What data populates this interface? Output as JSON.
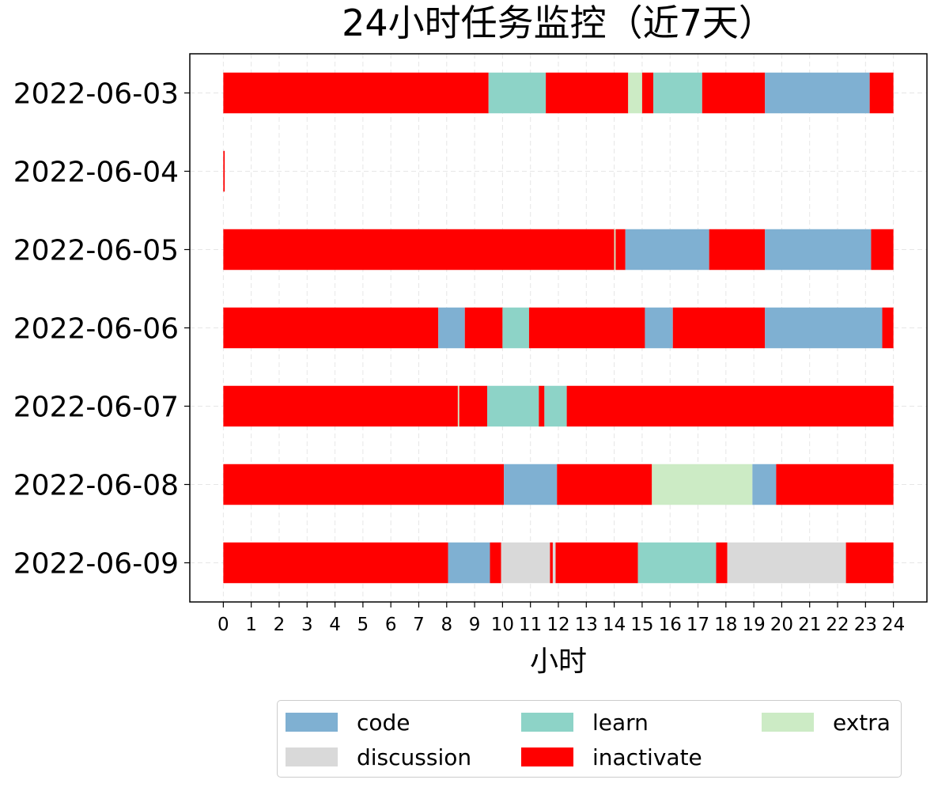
{
  "chart_data": {
    "type": "bar",
    "orientation": "horizontal",
    "stacked": true,
    "title": "24小时任务监控（近7天）",
    "xlabel": "小时",
    "ylabel": "",
    "xlim": [
      -1.2,
      25.2
    ],
    "x_ticks": [
      0,
      1,
      2,
      3,
      4,
      5,
      6,
      7,
      8,
      9,
      10,
      11,
      12,
      13,
      14,
      15,
      16,
      17,
      18,
      19,
      20,
      21,
      22,
      23,
      24
    ],
    "x_tick_labels": [
      "0",
      "1",
      "2",
      "3",
      "4",
      "5",
      "6",
      "7",
      "8",
      "9",
      "10",
      "11",
      "12",
      "13",
      "14",
      "15",
      "16",
      "17",
      "18",
      "19",
      "20",
      "21",
      "22",
      "23",
      "24"
    ],
    "grid": true,
    "legend_position": "bottom",
    "categories": [
      "2022-06-03",
      "2022-06-04",
      "2022-06-05",
      "2022-06-06",
      "2022-06-07",
      "2022-06-08",
      "2022-06-09"
    ],
    "colors": {
      "code": "#7fb0d2",
      "discussion": "#d9d9d9",
      "learn": "#8dd3c7",
      "inactivate": "#ff0000",
      "extra": "#ccebc5"
    },
    "legend": [
      "code",
      "discussion",
      "learn",
      "inactivate",
      "extra"
    ],
    "rows": [
      {
        "date": "2022-06-03",
        "segments": [
          {
            "start": 0,
            "end": 9.5,
            "type": "inactivate"
          },
          {
            "start": 9.5,
            "end": 11.55,
            "type": "learn"
          },
          {
            "start": 11.55,
            "end": 14.5,
            "type": "inactivate"
          },
          {
            "start": 14.5,
            "end": 15.0,
            "type": "extra"
          },
          {
            "start": 15.0,
            "end": 15.4,
            "type": "inactivate"
          },
          {
            "start": 15.4,
            "end": 17.15,
            "type": "learn"
          },
          {
            "start": 17.15,
            "end": 19.4,
            "type": "inactivate"
          },
          {
            "start": 19.4,
            "end": 23.15,
            "type": "code"
          },
          {
            "start": 23.15,
            "end": 24.0,
            "type": "inactivate"
          }
        ]
      },
      {
        "date": "2022-06-04",
        "segments": [
          {
            "start": 0,
            "end": 0.05,
            "type": "inactivate"
          }
        ]
      },
      {
        "date": "2022-06-05",
        "segments": [
          {
            "start": 0,
            "end": 14.0,
            "type": "inactivate"
          },
          {
            "start": 14.0,
            "end": 14.05,
            "type": "extra"
          },
          {
            "start": 14.05,
            "end": 14.4,
            "type": "inactivate"
          },
          {
            "start": 14.4,
            "end": 17.4,
            "type": "code"
          },
          {
            "start": 17.4,
            "end": 19.4,
            "type": "inactivate"
          },
          {
            "start": 19.4,
            "end": 23.2,
            "type": "code"
          },
          {
            "start": 23.2,
            "end": 24.0,
            "type": "inactivate"
          }
        ]
      },
      {
        "date": "2022-06-06",
        "segments": [
          {
            "start": 0,
            "end": 7.7,
            "type": "inactivate"
          },
          {
            "start": 7.7,
            "end": 8.65,
            "type": "code"
          },
          {
            "start": 8.65,
            "end": 10.0,
            "type": "inactivate"
          },
          {
            "start": 10.0,
            "end": 10.95,
            "type": "learn"
          },
          {
            "start": 10.95,
            "end": 15.1,
            "type": "inactivate"
          },
          {
            "start": 15.1,
            "end": 16.1,
            "type": "code"
          },
          {
            "start": 16.1,
            "end": 19.4,
            "type": "inactivate"
          },
          {
            "start": 19.4,
            "end": 23.6,
            "type": "code"
          },
          {
            "start": 23.6,
            "end": 24.0,
            "type": "inactivate"
          }
        ]
      },
      {
        "date": "2022-06-07",
        "segments": [
          {
            "start": 0,
            "end": 8.4,
            "type": "inactivate"
          },
          {
            "start": 8.4,
            "end": 8.45,
            "type": "extra"
          },
          {
            "start": 8.45,
            "end": 9.45,
            "type": "inactivate"
          },
          {
            "start": 9.45,
            "end": 11.3,
            "type": "learn"
          },
          {
            "start": 11.3,
            "end": 11.5,
            "type": "inactivate"
          },
          {
            "start": 11.5,
            "end": 12.3,
            "type": "learn"
          },
          {
            "start": 12.3,
            "end": 24.0,
            "type": "inactivate"
          }
        ]
      },
      {
        "date": "2022-06-08",
        "segments": [
          {
            "start": 0,
            "end": 10.05,
            "type": "inactivate"
          },
          {
            "start": 10.05,
            "end": 11.95,
            "type": "code"
          },
          {
            "start": 11.95,
            "end": 15.35,
            "type": "inactivate"
          },
          {
            "start": 15.35,
            "end": 18.95,
            "type": "extra"
          },
          {
            "start": 18.95,
            "end": 19.8,
            "type": "code"
          },
          {
            "start": 19.8,
            "end": 24.0,
            "type": "inactivate"
          }
        ]
      },
      {
        "date": "2022-06-09",
        "segments": [
          {
            "start": 0,
            "end": 8.05,
            "type": "inactivate"
          },
          {
            "start": 8.05,
            "end": 9.55,
            "type": "code"
          },
          {
            "start": 9.55,
            "end": 9.95,
            "type": "inactivate"
          },
          {
            "start": 9.95,
            "end": 11.7,
            "type": "discussion"
          },
          {
            "start": 11.7,
            "end": 11.8,
            "type": "inactivate"
          },
          {
            "start": 11.8,
            "end": 11.9,
            "type": "discussion"
          },
          {
            "start": 11.9,
            "end": 14.85,
            "type": "inactivate"
          },
          {
            "start": 14.85,
            "end": 17.65,
            "type": "learn"
          },
          {
            "start": 17.65,
            "end": 18.05,
            "type": "inactivate"
          },
          {
            "start": 18.05,
            "end": 22.3,
            "type": "discussion"
          },
          {
            "start": 22.3,
            "end": 24.0,
            "type": "inactivate"
          }
        ]
      }
    ]
  }
}
